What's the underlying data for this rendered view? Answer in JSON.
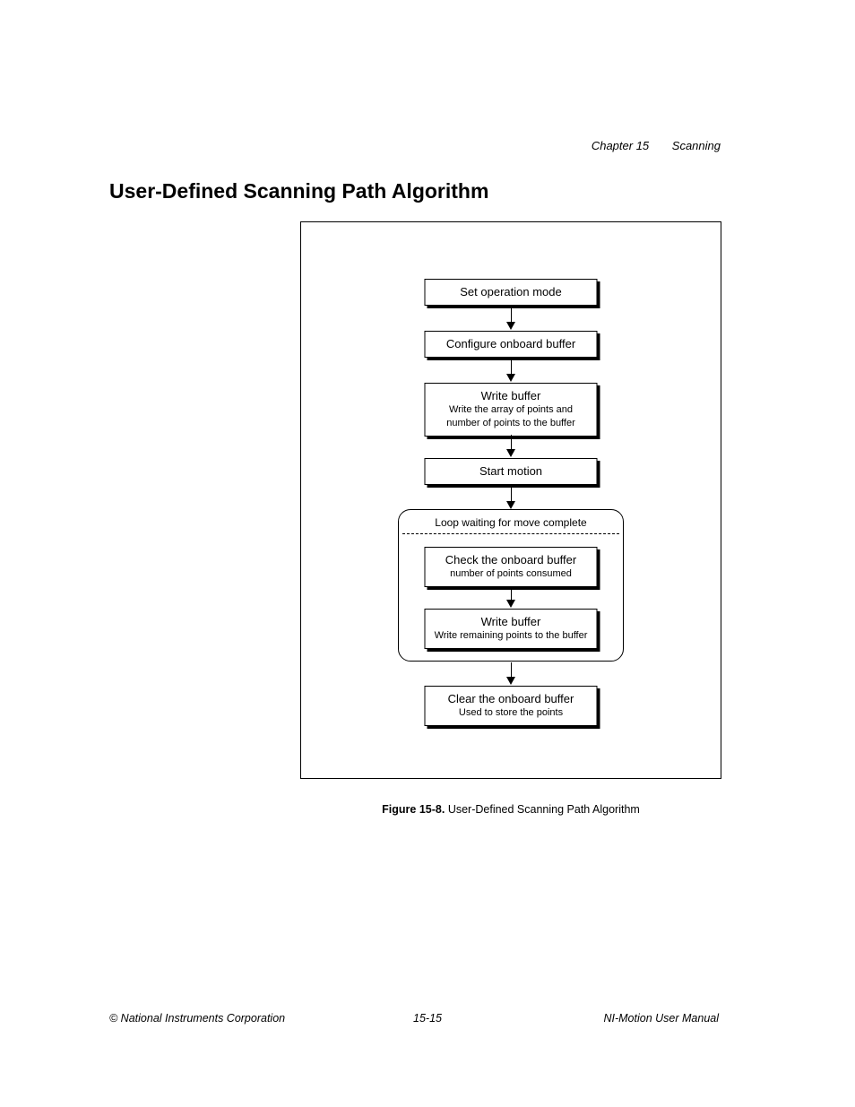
{
  "header": {
    "chapter": "Chapter 15",
    "title": "Scanning"
  },
  "section_title": "User-Defined Scanning Path Algorithm",
  "flow": {
    "n1": {
      "title": "Set operation mode"
    },
    "n2": {
      "title": "Configure onboard buffer"
    },
    "n3": {
      "title": "Write buffer",
      "sub1": "Write the array of points and",
      "sub2": "number of points to the buffer"
    },
    "n4": {
      "title": "Start motion"
    },
    "loop_label": "Loop waiting for move complete",
    "n5": {
      "title": "Check the onboard buffer",
      "sub1": "number of points consumed"
    },
    "n6": {
      "title": "Write buffer",
      "sub1": "Write remaining points to the buffer"
    },
    "n7": {
      "title": "Clear the onboard buffer",
      "sub1": "Used to store the points"
    }
  },
  "caption": {
    "bold": "Figure 15-8.",
    "text": "  User-Defined Scanning Path Algorithm"
  },
  "footer": {
    "copyright": "© National Instruments Corporation",
    "page": "15-15",
    "manual": "NI-Motion User Manual"
  }
}
